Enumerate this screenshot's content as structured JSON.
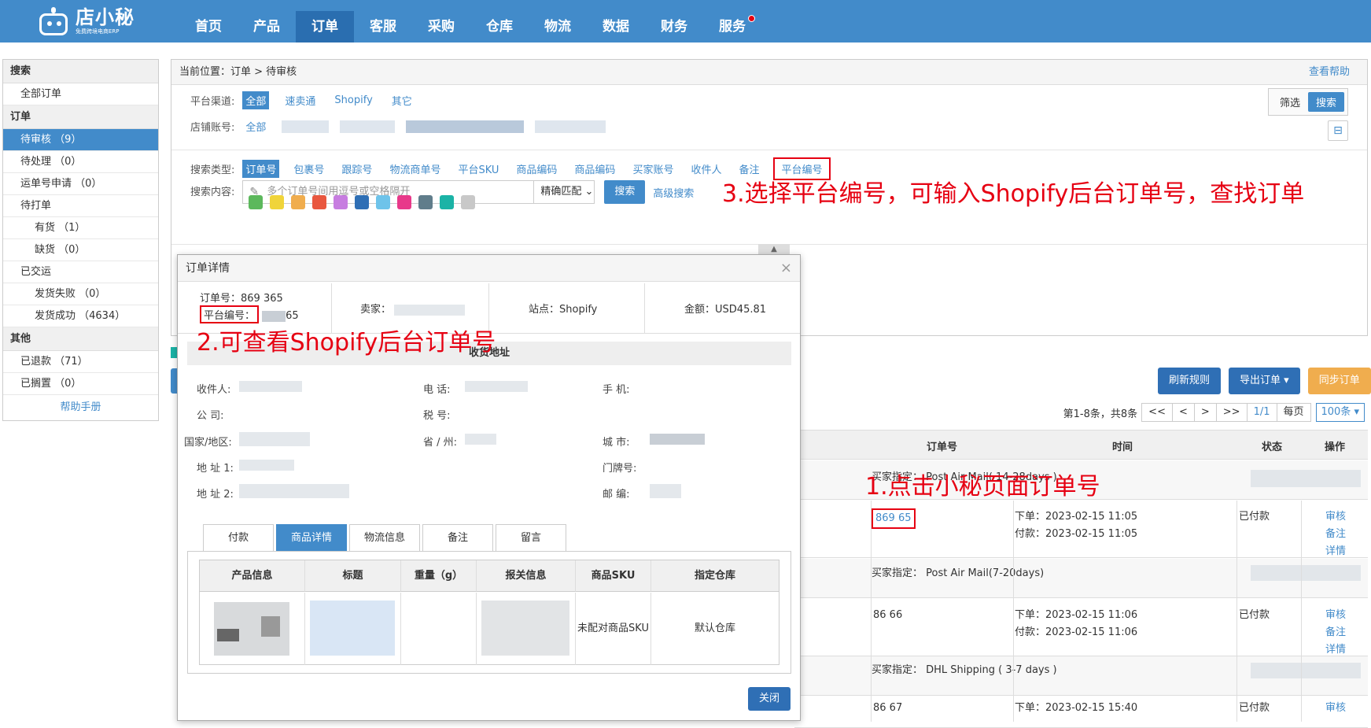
{
  "brand": {
    "name": "店小秘",
    "sub": "免费跨境电商ERP"
  },
  "nav": [
    "首页",
    "产品",
    "订单",
    "客服",
    "采购",
    "仓库",
    "物流",
    "数据",
    "财务",
    "服务"
  ],
  "sidebar": {
    "search_h": "搜索",
    "all_orders": "全部订单",
    "order_h": "订单",
    "pending_review": "待审核 （9）",
    "pending": "待处理 （0）",
    "waybill": "运单号申请 （0）",
    "to_print": "待打单",
    "in_stock": "有货 （1）",
    "out_stock": "缺货 （0）",
    "shipped": "已交运",
    "ship_fail": "发货失败 （0）",
    "ship_ok": "发货成功 （4634）",
    "other_h": "其他",
    "refunded": "已退款 （71）",
    "shelved": "已搁置 （0）",
    "manual": "帮助手册"
  },
  "panel": {
    "crumb_label": "当前位置：",
    "crumb": "订单 > 待审核",
    "help": "查看帮助",
    "channel_label": "平台渠道:",
    "channels": [
      "全部",
      "速卖通",
      "Shopify",
      "其它"
    ],
    "shop_label": "店铺账号:",
    "shop_all": "全部",
    "filter": "筛选",
    "search": "搜索",
    "type_label": "搜索类型:",
    "types": [
      "订单号",
      "包裹号",
      "跟踪号",
      "物流商单号",
      "平台SKU",
      "商品编码",
      "商品编码",
      "买家账号",
      "收件人",
      "备注"
    ],
    "type_platform": "平台编号",
    "content_label": "搜索内容:",
    "content_placeholder": "多个订单号间用逗号或空格隔开",
    "match": "精确匹配",
    "search_btn": "搜索",
    "adv": "高级搜索"
  },
  "annotations": {
    "a1": "1.点击小秘页面订单号",
    "a2": "2.可查看Shopify后台订单号",
    "a3": "3.选择平台编号，可输入Shopify后台订单号，查找订单"
  },
  "toolbar": {
    "refresh": "刷新规则",
    "export": "导出订单 ▾",
    "sync": "同步订单"
  },
  "pager": {
    "summary": "第1-8条，共8条",
    "first": "<<",
    "prev": "<",
    "next": ">",
    "last": ">>",
    "page": "1/1",
    "per": "每页",
    "per_sel": "100条 ▾"
  },
  "table": {
    "headers": {
      "order": "订单号",
      "time": "时间",
      "status": "状态",
      "ops": "操作"
    },
    "buyer1": "买家指定： Post Air Mail( 14-28days )",
    "buyer2": "买家指定：  Post Air Mail(7-20days)",
    "buyer3": "买家指定：  DHL Shipping ( 3-7 days )",
    "rows": [
      {
        "id": "869 65",
        "order_time": "下单：2023-02-15 11:05",
        "pay_time": "付款：2023-02-15 11:05",
        "status": "已付款"
      },
      {
        "id": "86 66",
        "order_time": "下单：2023-02-15 11:06",
        "pay_time": "付款：2023-02-15 11:06",
        "status": "已付款"
      },
      {
        "id": "86 67",
        "order_time": "下单：2023-02-15 15:40",
        "pay_time": "",
        "status": "已付款"
      }
    ],
    "ops": [
      "审核",
      "备注",
      "详情"
    ]
  },
  "modal": {
    "title": "订单详情",
    "order_no_label": "订单号：",
    "order_no": "869 365",
    "platform_label": "平台编号：",
    "platform_no": "65",
    "seller_label": "卖家：",
    "site_label": "站点：",
    "site": "Shopify",
    "amount_label": "金额：",
    "amount": "USD45.81",
    "addr_header": "收货地址",
    "receiver": "收件人:",
    "phone": "电   话:",
    "mobile": "手   机:",
    "company": "公   司:",
    "tax": "税   号:",
    "country": "国家/地区:",
    "province": "省 / 州:",
    "city": "城   市:",
    "addr1": "地 址 1:",
    "door": "门牌号:",
    "addr2": "地 址 2:",
    "zip": "邮   编:",
    "tabs": [
      "付款",
      "商品详情",
      "物流信息",
      "备注",
      "留言"
    ],
    "cols": [
      "产品信息",
      "标题",
      "重量（g）",
      "报关信息",
      "商品SKU",
      "指定仓库"
    ],
    "sku": "未配对商品SKU",
    "warehouse": "默认仓库",
    "close": "关闭"
  },
  "colors": {
    "primary": "#428bca",
    "annotation": "#e60012",
    "sync": "#f0ad4e",
    "tags": [
      "#5cb85c",
      "#f0d43a",
      "#f0ad4e",
      "#e9573f",
      "#c77de0",
      "#2f6fb5",
      "#6ec3ea",
      "#e8398a",
      "#607d8b",
      "#1bb3a6",
      "#c8c8c8"
    ]
  }
}
